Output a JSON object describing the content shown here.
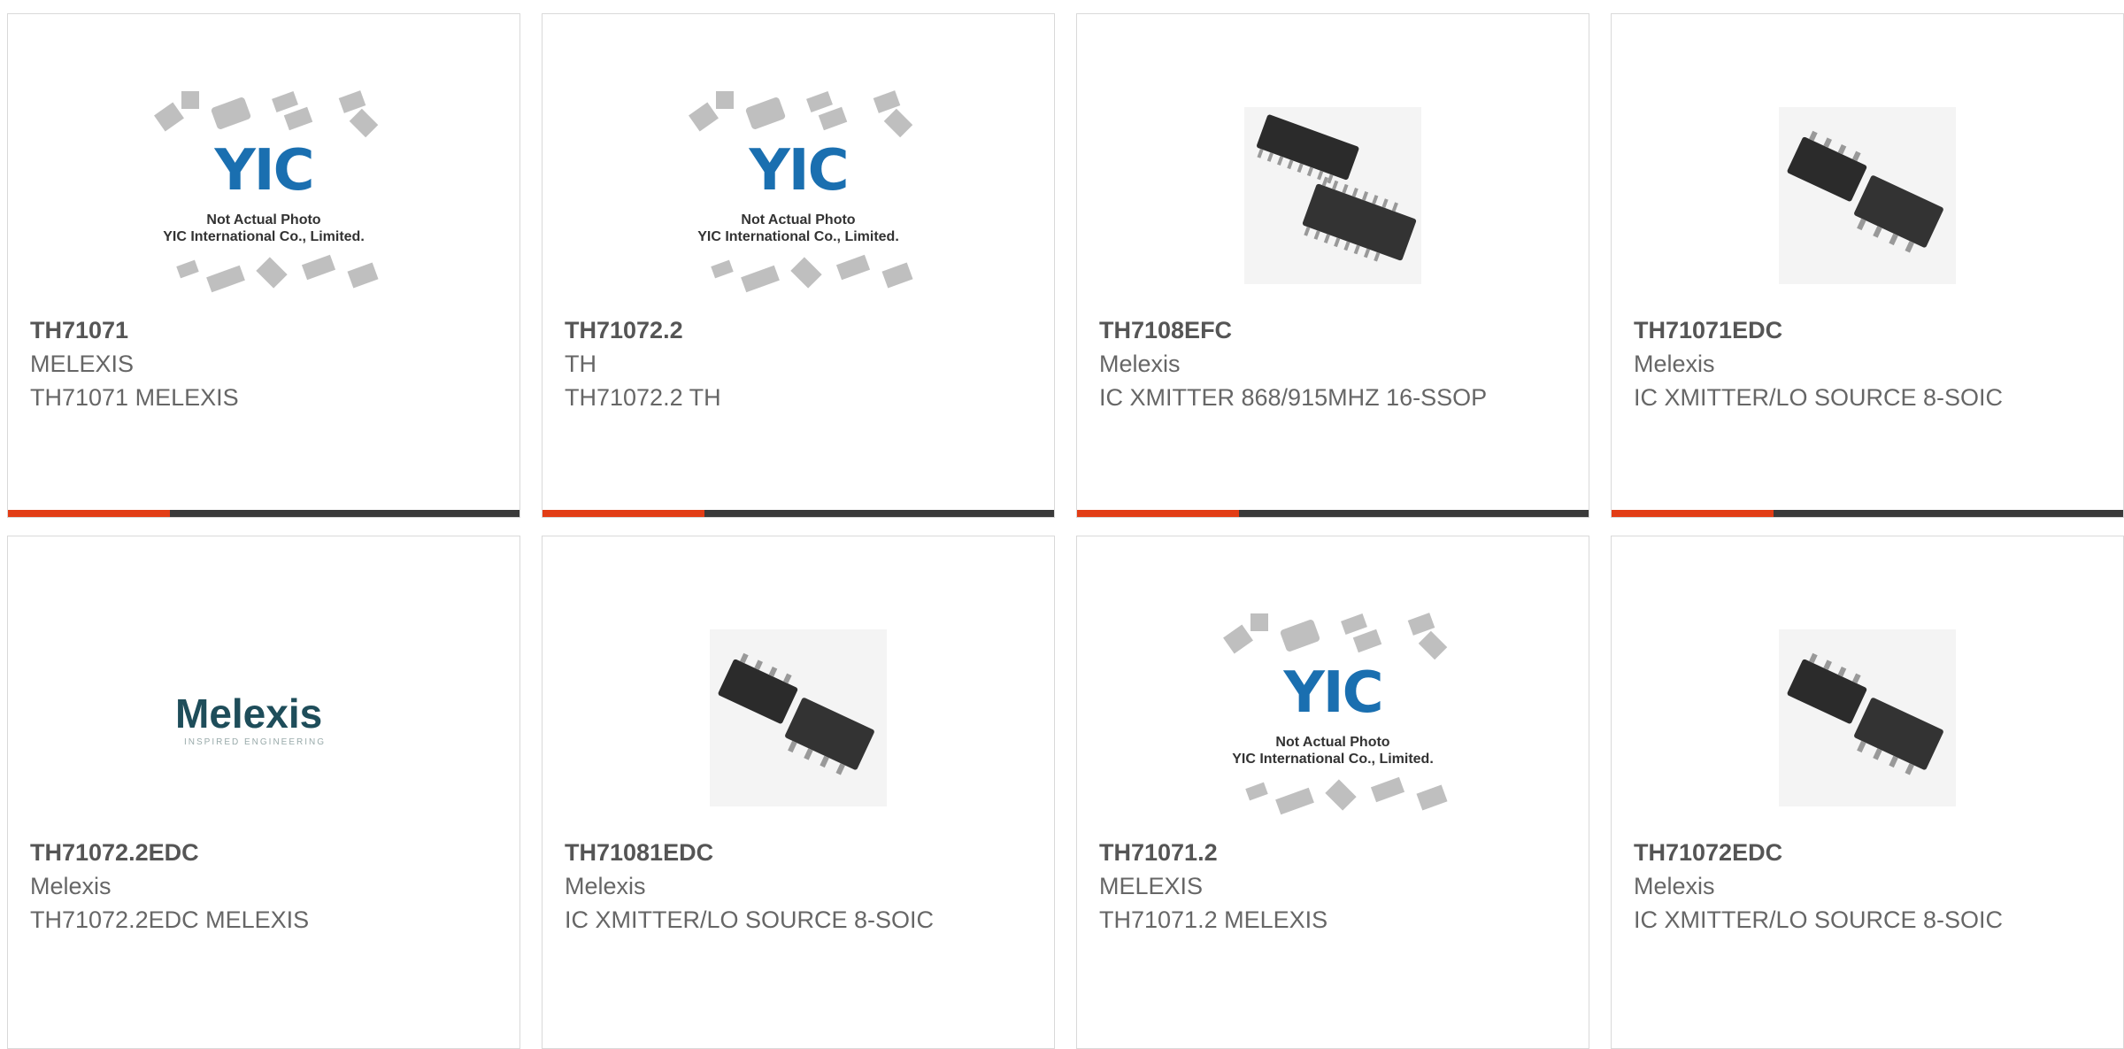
{
  "products": [
    {
      "part": "TH71071",
      "manufacturer": "MELEXIS",
      "description": "TH71071 MELEXIS",
      "image": "placeholder"
    },
    {
      "part": "TH71072.2",
      "manufacturer": "TH",
      "description": "TH71072.2 TH",
      "image": "placeholder"
    },
    {
      "part": "TH7108EFC",
      "manufacturer": "Melexis",
      "description": "IC XMITTER 868/915MHZ 16-SSOP",
      "image": "ssop-photo"
    },
    {
      "part": "TH71071EDC",
      "manufacturer": "Melexis",
      "description": "IC XMITTER/LO SOURCE 8-SOIC",
      "image": "soic-photo"
    },
    {
      "part": "TH71072.2EDC",
      "manufacturer": "Melexis",
      "description": "TH71072.2EDC MELEXIS",
      "image": "melexis-logo"
    },
    {
      "part": "TH71081EDC",
      "manufacturer": "Melexis",
      "description": "IC XMITTER/LO SOURCE 8-SOIC",
      "image": "soic-photo"
    },
    {
      "part": "TH71071.2",
      "manufacturer": "MELEXIS",
      "description": "TH71071.2 MELEXIS",
      "image": "placeholder"
    },
    {
      "part": "TH71072EDC",
      "manufacturer": "Melexis",
      "description": "IC XMITTER/LO SOURCE 8-SOIC",
      "image": "soic-photo"
    }
  ],
  "placeholder": {
    "logo": "YIC",
    "caption_line1": "Not Actual Photo",
    "caption_line2": "YIC International Co., Limited."
  },
  "melexis_logo": {
    "word": "Melexis",
    "tagline": "INSPIRED ENGINEERING"
  },
  "colors": {
    "accent": "#e23d16",
    "bar": "#3a3a3a",
    "border": "#d9d9d9"
  }
}
